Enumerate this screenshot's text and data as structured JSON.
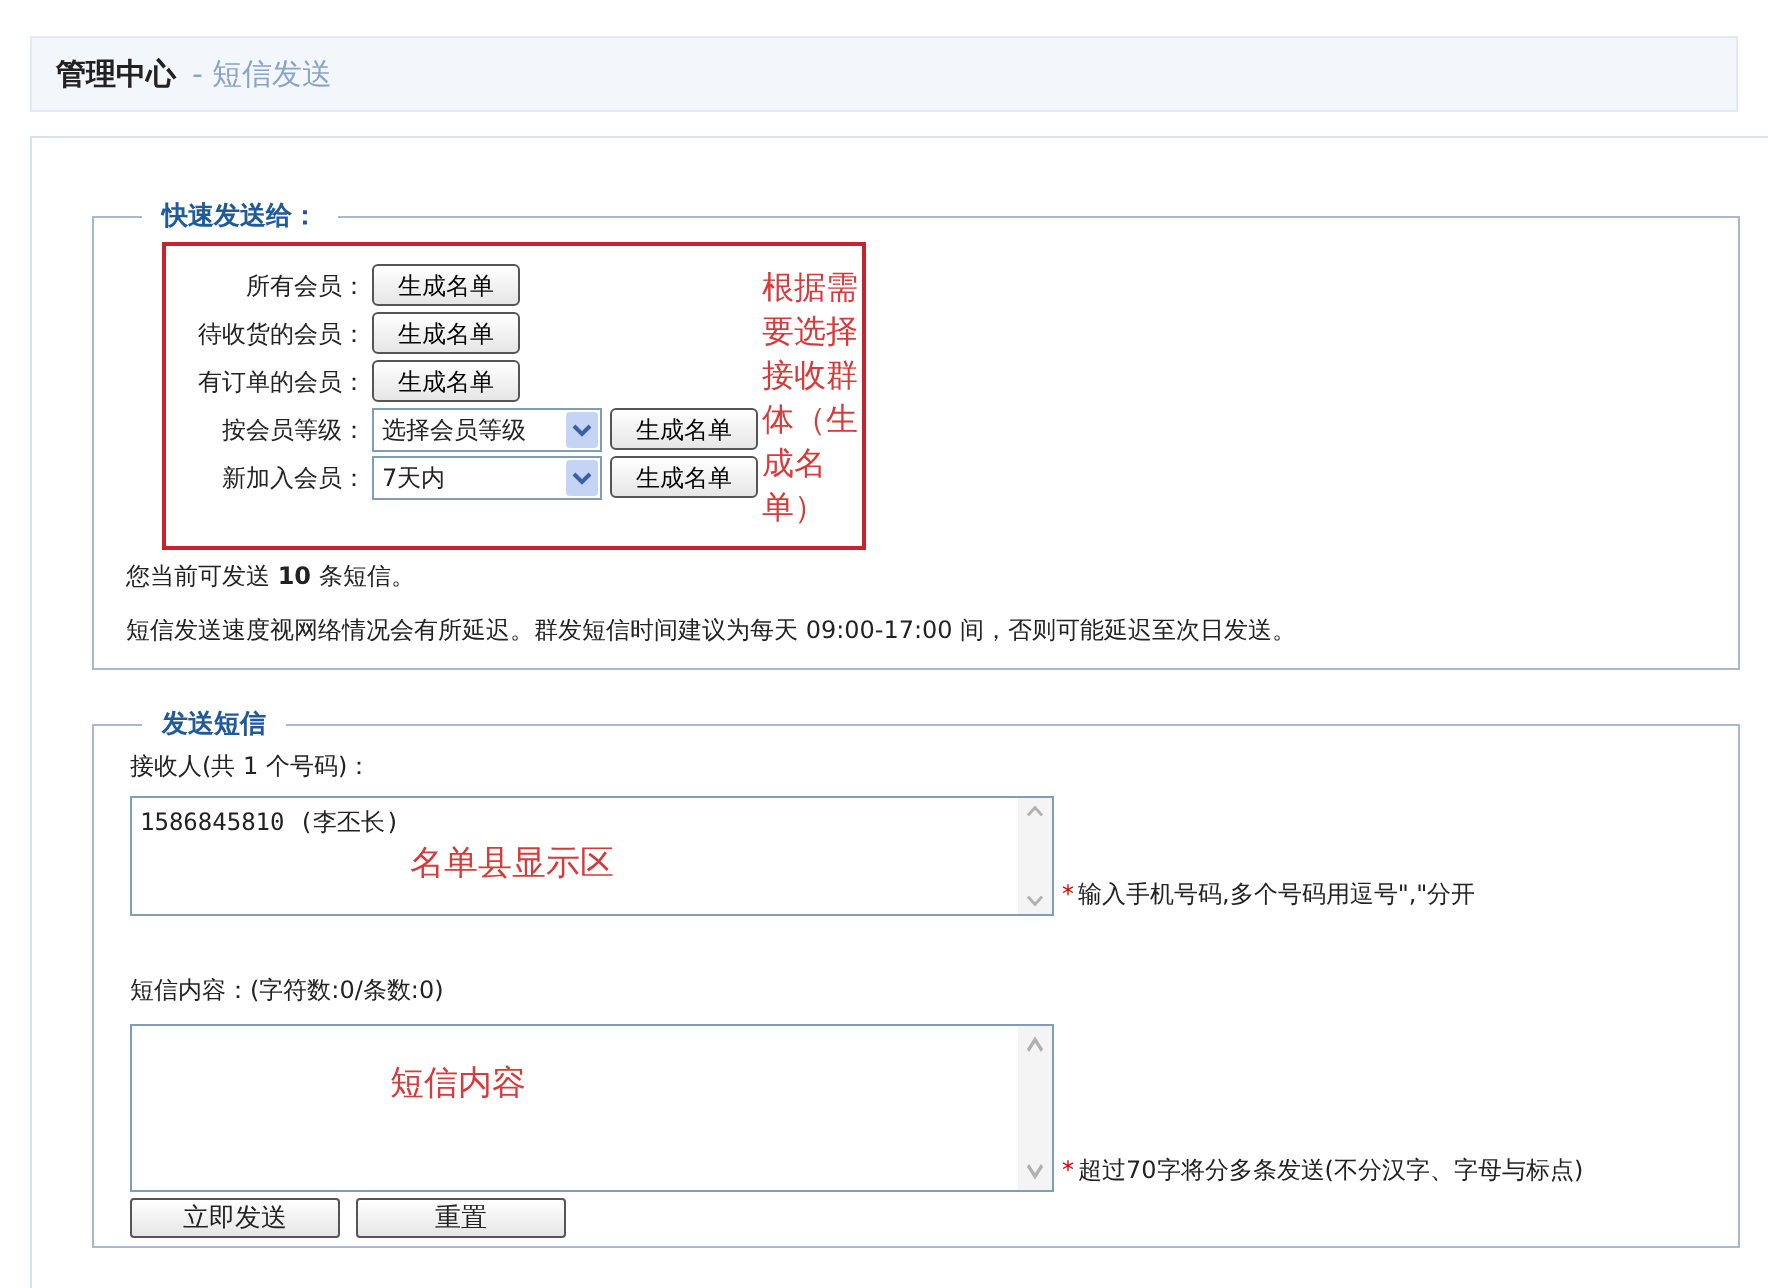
{
  "header": {
    "title": "管理中心",
    "subtitle": "- 短信发送"
  },
  "quick_send": {
    "legend": "快速发送给：",
    "rows": [
      {
        "kind": "button",
        "label": "所有会员：",
        "button": "生成名单"
      },
      {
        "kind": "button",
        "label": "待收货的会员：",
        "button": "生成名单"
      },
      {
        "kind": "button",
        "label": "有订单的会员：",
        "button": "生成名单"
      },
      {
        "kind": "select",
        "label": "按会员等级：",
        "select_value": "选择会员等级",
        "button": "生成名单"
      },
      {
        "kind": "select",
        "label": "新加入会员：",
        "select_value": "7天内",
        "button": "生成名单"
      }
    ],
    "annotation": "根据需要选择接收群体（生成名单）",
    "quota": "您当前可发送 **10** 条短信。",
    "notice": "短信发送速度视网络情况会有所延迟。群发短信时间建议为每天 09:00-17:00 间，否则可能延迟至次日发送。"
  },
  "send": {
    "legend": "发送短信",
    "recipients": {
      "label": "接收人(共 1 个号码)：",
      "value": "1586845810 (李丕长)",
      "annotation": "名单县显示区",
      "required_mark": "*",
      "hint": "输入手机号码,多个号码用逗号\",\"分开"
    },
    "content": {
      "label": "短信内容：(字符数:0/条数:0)",
      "annotation": "短信内容",
      "required_mark": "*",
      "hint": "超过70字将分多条发送(不分汉字、字母与标点)"
    },
    "buttons": [
      "立即发送",
      "重置"
    ]
  }
}
